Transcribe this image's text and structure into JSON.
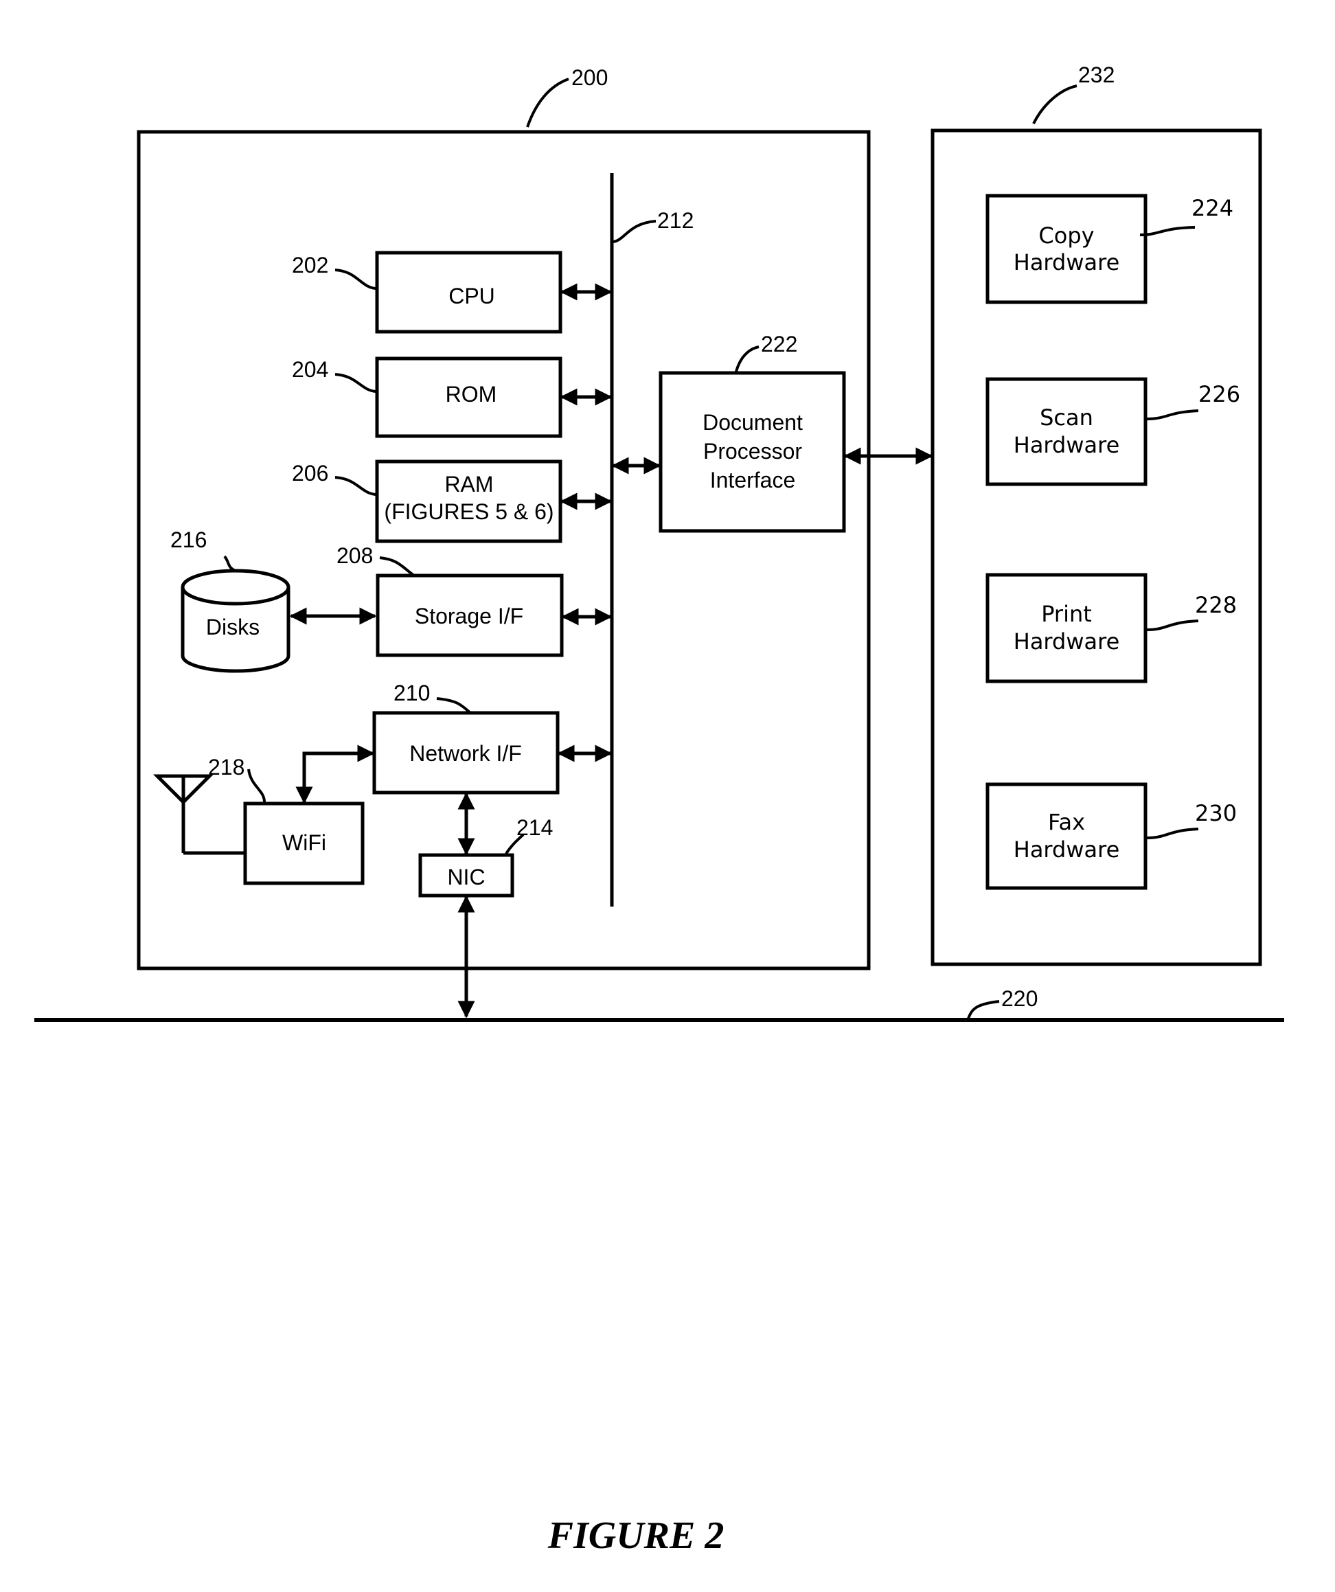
{
  "figure": {
    "caption": "FIGURE 2",
    "controller": {
      "ref": "200",
      "bus_ref": "212",
      "components": {
        "cpu": {
          "ref": "202",
          "label": "CPU"
        },
        "rom": {
          "ref": "204",
          "label": "ROM"
        },
        "ram": {
          "ref": "206",
          "label_line1": "RAM",
          "label_line2": "(FIGURES 5 & 6)"
        },
        "storage_if": {
          "ref": "208",
          "label": "Storage I/F"
        },
        "network_if": {
          "ref": "210",
          "label": "Network I/F"
        },
        "nic": {
          "ref": "214",
          "label": "NIC"
        },
        "disks": {
          "ref": "216",
          "label": "Disks"
        },
        "wifi": {
          "ref": "218",
          "label": "WiFi"
        },
        "document_processor_interface": {
          "ref": "222",
          "label_line1": "Document",
          "label_line2": "Processor",
          "label_line3": "Interface"
        }
      }
    },
    "document_processor": {
      "ref": "232",
      "components": {
        "copy": {
          "ref": "224",
          "label_line1": "Copy",
          "label_line2": "Hardware"
        },
        "scan": {
          "ref": "226",
          "label_line1": "Scan",
          "label_line2": "Hardware"
        },
        "print": {
          "ref": "228",
          "label_line1": "Print",
          "label_line2": "Hardware"
        },
        "fax": {
          "ref": "230",
          "label_line1": "Fax",
          "label_line2": "Hardware"
        }
      }
    },
    "network": {
      "ref": "220"
    }
  }
}
